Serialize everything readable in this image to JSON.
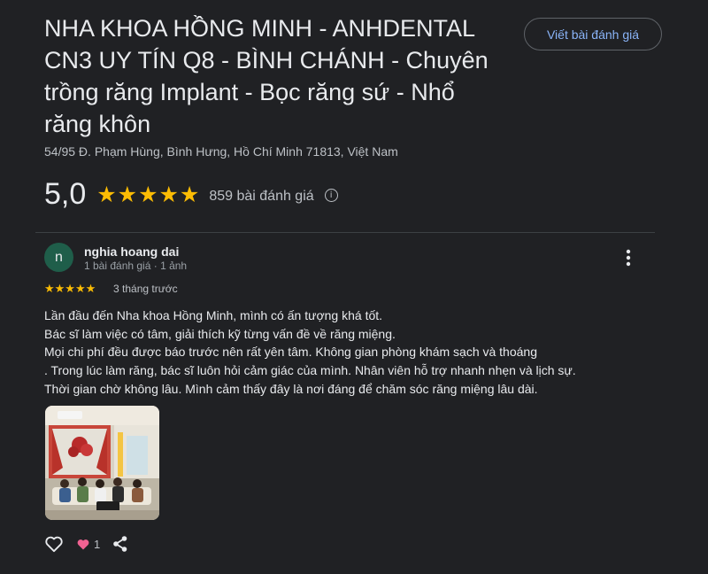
{
  "place": {
    "title_lines": [
      "NHA KHOA HỒNG MINH - ANHDENTAL",
      "CN3 UY TÍN Q8 - BÌNH CHÁNH - Chuyên",
      "trồng răng Implant - Bọc răng sứ - Nhổ",
      "răng khôn"
    ],
    "address": "54/95 Đ. Phạm Hùng, Bình Hưng, Hồ Chí Minh 71813, Việt Nam",
    "rating": "5,0",
    "rating_stars": 5,
    "review_count": "859 bài đánh giá"
  },
  "write_review_label": "Viết bài đánh giá",
  "review": {
    "avatar_letter": "n",
    "reviewer_name": "nghia hoang dai",
    "reviewer_meta": "1 bài đánh giá · 1 ảnh",
    "stars": 5,
    "time": "3 tháng trước",
    "text_lines": [
      "Lần đầu đến Nha khoa Hồng Minh, mình có ấn tượng khá tốt.",
      "Bác sĩ làm việc có tâm, giải thích kỹ từng vấn đề về răng miệng.",
      "Mọi chi phí đều được báo trước nên rất yên tâm. Không gian phòng khám sạch và thoáng",
      ". Trong lúc làm răng, bác sĩ luôn hỏi cảm giác của mình. Nhân viên hỗ trợ nhanh nhẹn và lịch sự.",
      "Thời gian chờ không lâu. Mình cảm thấy đây là nơi đáng để chăm sóc răng miệng lâu dài."
    ],
    "reaction_count": "1"
  },
  "icons": {
    "info": "info-icon",
    "more": "more-vert-icon",
    "like": "heart-outline-icon",
    "reaction": "heart-reaction-icon",
    "share": "share-icon"
  },
  "colors": {
    "background": "#202124",
    "star": "#fbbc04",
    "link": "#8ab4f8",
    "avatar": "#1f5e4a",
    "reaction": "#f06292"
  }
}
